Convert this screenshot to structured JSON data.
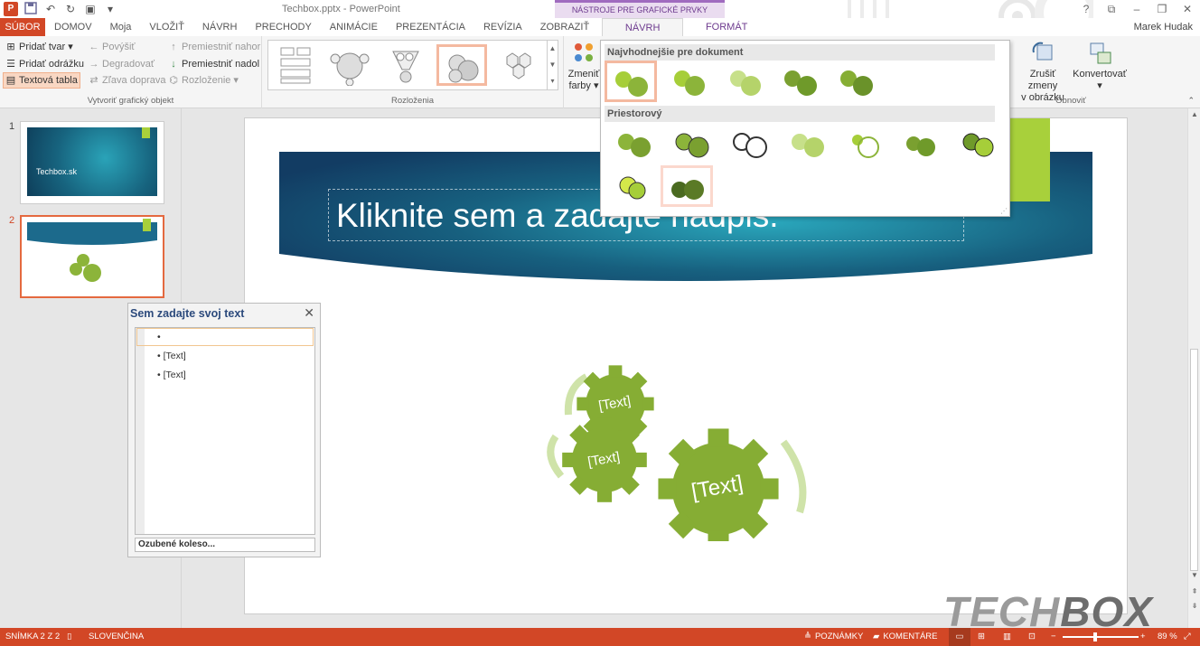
{
  "titlebar": {
    "doc_title": "Techbox.pptx - PowerPoint",
    "context_header": "NÁSTROJE PRE GRAFICKÉ PRVKY SMARTART",
    "app_icon": "P",
    "help": "?"
  },
  "tabs": [
    "SÚBOR",
    "DOMOV",
    "Moja",
    "VLOŽIŤ",
    "NÁVRH",
    "PRECHODY",
    "ANIMÁCIE",
    "PREZENTÁCIA",
    "REVÍZIA",
    "ZOBRAZIŤ",
    "NÁVRH",
    "FORMÁT"
  ],
  "user": "Marek Hudak",
  "ribbon": {
    "create": {
      "add_shape": "Pridať tvar",
      "promote": "Povýšiť",
      "move_up": "Premiestniť nahor",
      "add_bullet": "Pridať odrážku",
      "demote": "Degradovať",
      "move_down": "Premiestniť nadol",
      "text_pane": "Textová tabla",
      "rtl": "Zľava doprava",
      "layout": "Rozloženie",
      "label": "Vytvoriť grafický objekt"
    },
    "layouts_label": "Rozloženia",
    "change_colors_1": "Zmeniť",
    "change_colors_2": "farby",
    "reset_1": "Zrušiť zmeny",
    "reset_2": "v obrázku",
    "convert": "Konvertovať",
    "reset_label": "Obnoviť"
  },
  "gallery": {
    "section1": "Najvhodnejšie pre dokument",
    "section2": "Priestorový"
  },
  "slides": [
    {
      "number": "1",
      "thumb_title": "Techbox.sk"
    },
    {
      "number": "2"
    }
  ],
  "slide": {
    "title_placeholder": "Kliknite sem a zadajte nadpis.",
    "gear_texts": [
      "[Text]",
      "[Text]",
      "[Text]"
    ]
  },
  "text_pane": {
    "title": "Sem zadajte svoj text",
    "items": [
      "",
      "[Text]",
      "[Text]"
    ],
    "footer": "Ozubené koleso..."
  },
  "status": {
    "slide": "SNÍMKA 2 Z 2",
    "language": "SLOVENČINA",
    "notes": "POZNÁMKY",
    "comments": "KOMENTÁRE",
    "zoom": "89 %"
  },
  "watermark": {
    "part1": "TECH",
    "part2": "BOX"
  },
  "colors": {
    "accent": "#d24726",
    "smartart": "#a04bc4",
    "gear_green": "#8cb43a",
    "slide_band": "#1c6a8c"
  }
}
